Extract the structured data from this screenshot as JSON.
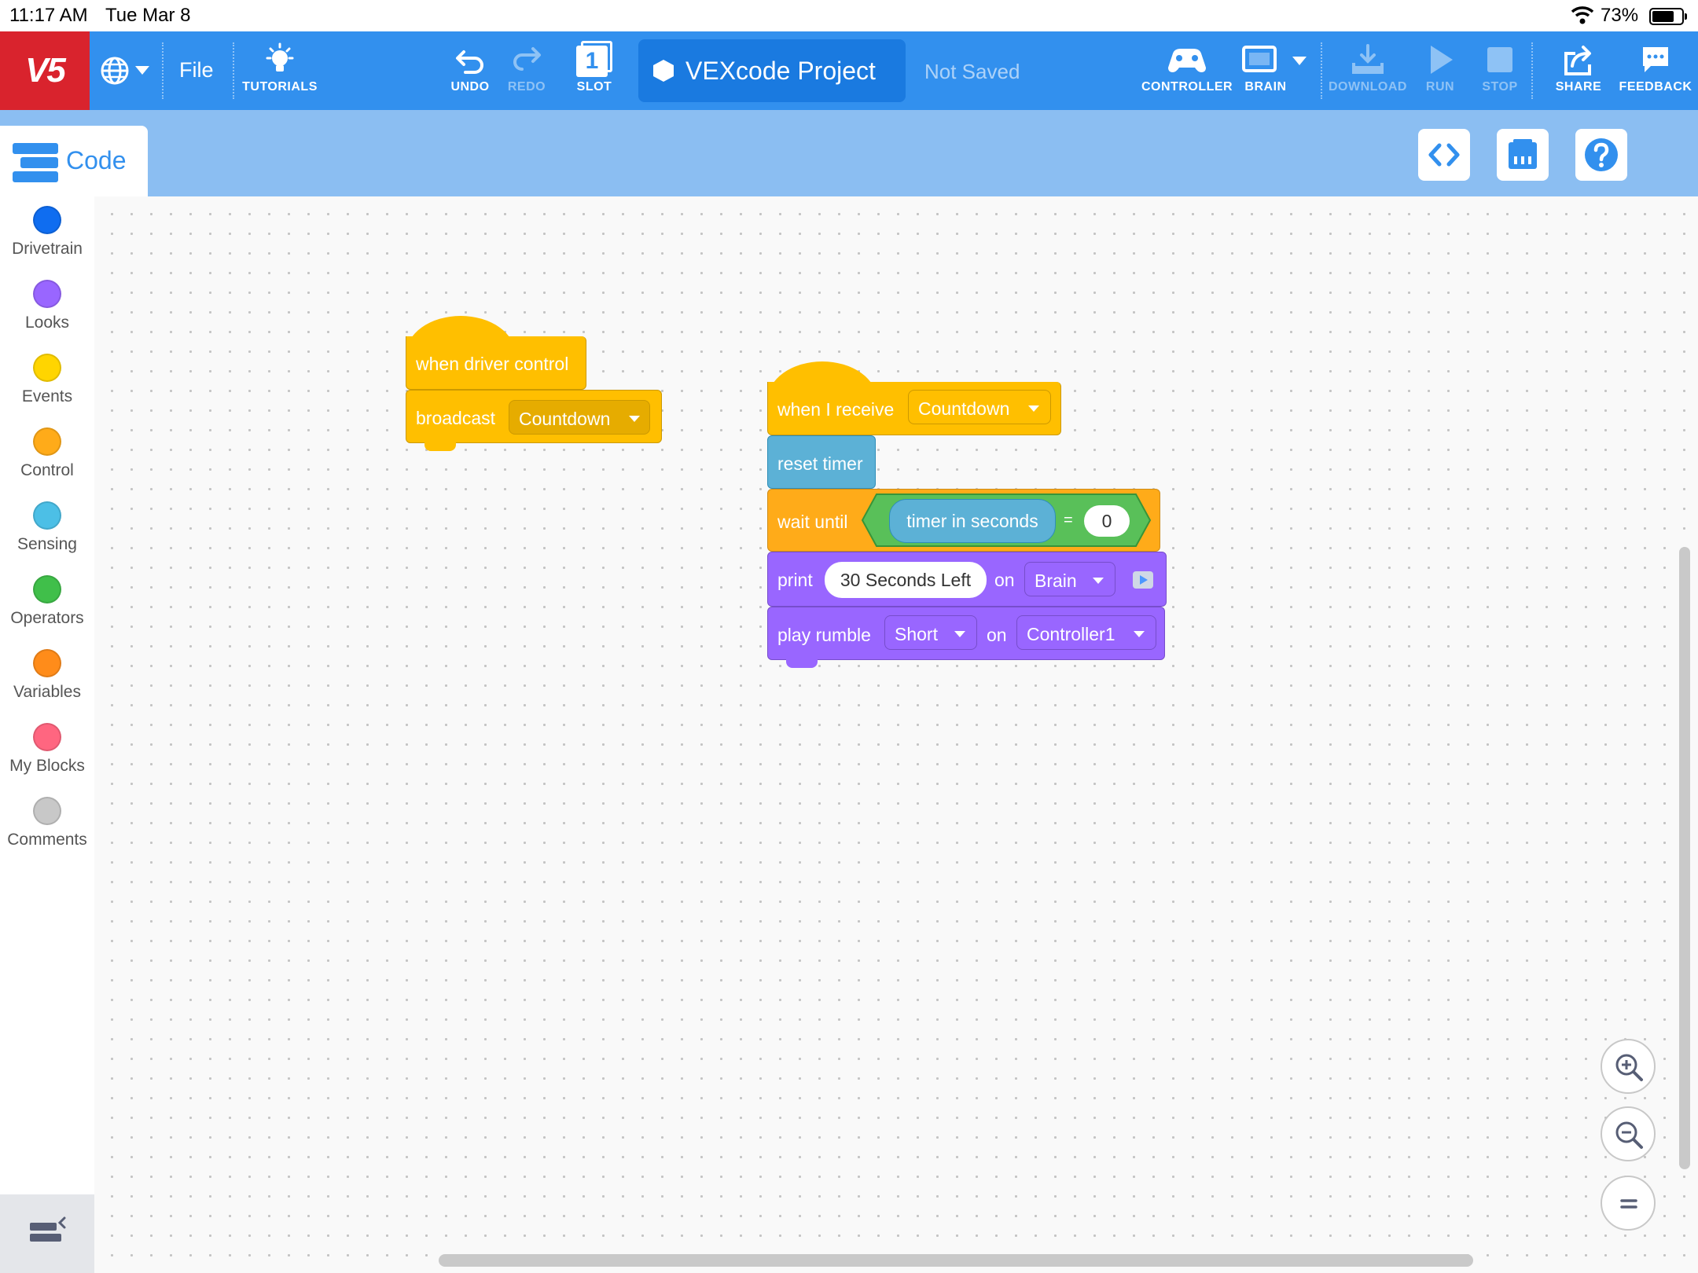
{
  "status_bar": {
    "time": "11:17 AM",
    "date": "Tue Mar 8",
    "battery_percent": "73%",
    "battery_level": 0.73
  },
  "toolbar": {
    "logo": "V5",
    "file": "File",
    "tutorials": "TUTORIALS",
    "undo": "UNDO",
    "redo": "REDO",
    "slot": "SLOT",
    "slot_number": "1",
    "project_name": "VEXcode Project",
    "save_status": "Not Saved",
    "controller": "CONTROLLER",
    "brain": "BRAIN",
    "download": "DOWNLOAD",
    "run": "RUN",
    "stop": "STOP",
    "share": "SHARE",
    "feedback": "FEEDBACK"
  },
  "code_tab": {
    "label": "Code"
  },
  "palette": {
    "categories": [
      {
        "label": "Drivetrain",
        "color": "#0f6df0"
      },
      {
        "label": "Looks",
        "color": "#9966ff"
      },
      {
        "label": "Events",
        "color": "#ffd500"
      },
      {
        "label": "Control",
        "color": "#ffab19"
      },
      {
        "label": "Sensing",
        "color": "#4cbfe6"
      },
      {
        "label": "Operators",
        "color": "#40bf4a"
      },
      {
        "label": "Variables",
        "color": "#ff8c1a"
      },
      {
        "label": "My Blocks",
        "color": "#ff6680"
      },
      {
        "label": "Comments",
        "color": "#c8c8c8"
      }
    ]
  },
  "blocks": {
    "stack1": {
      "hat": "when driver control",
      "broadcast": "broadcast",
      "broadcast_message": "Countdown"
    },
    "stack2": {
      "hat": "when I receive",
      "hat_message": "Countdown",
      "reset_timer": "reset timer",
      "wait_until": "wait until",
      "timer_reporter": "timer in seconds",
      "equals": "=",
      "compare_value": "0",
      "print": "print",
      "print_text": "30 Seconds Left",
      "print_on": "on",
      "print_target": "Brain",
      "rumble": "play rumble",
      "rumble_pattern": "Short",
      "rumble_on": "on",
      "rumble_target": "Controller1"
    }
  },
  "colors": {
    "toolbar": "#3290ee",
    "logo": "#d9232d",
    "events": "#ffbf00",
    "control": "#ffab19",
    "sensing": "#5cb1d6",
    "operators": "#59c059",
    "looks": "#9966ff"
  }
}
